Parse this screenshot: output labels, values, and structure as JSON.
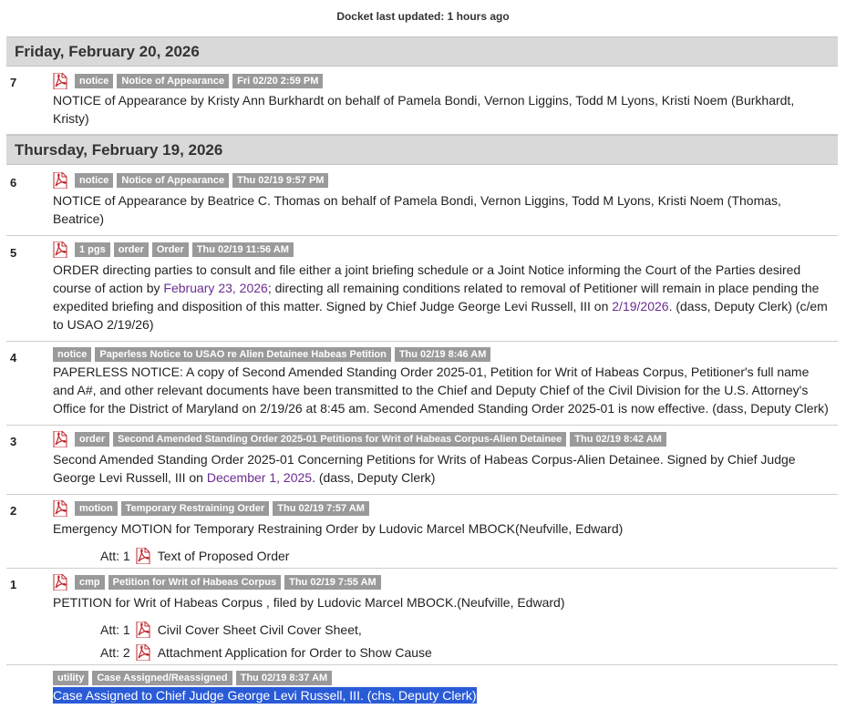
{
  "header": {
    "updated": "Docket last updated: 1 hours ago"
  },
  "days": [
    "Friday, February 20, 2026",
    "Thursday, February 19, 2026"
  ],
  "entries": [
    {
      "num": "7",
      "tags": [
        "notice",
        "Notice of Appearance",
        "Fri 02/20 2:59 PM"
      ],
      "text": "NOTICE of Appearance by Kristy Ann Burkhardt on behalf of Pamela Bondi, Vernon Liggins, Todd M Lyons, Kristi Noem (Burkhardt, Kristy)"
    },
    {
      "num": "6",
      "tags": [
        "notice",
        "Notice of Appearance",
        "Thu 02/19 9:57 PM"
      ],
      "text": "NOTICE of Appearance by Beatrice C. Thomas on behalf of Pamela Bondi, Vernon Liggins, Todd M Lyons, Kristi Noem (Thomas, Beatrice)"
    },
    {
      "num": "5",
      "tags": [
        "1 pgs",
        "order",
        "Order",
        "Thu 02/19 11:56 AM"
      ],
      "text_a": "ORDER directing parties to consult and file either a joint briefing schedule or a Joint Notice informing the Court of the Parties desired course of action by ",
      "link_a": "February 23, 2026",
      "text_b": "; directing all remaining conditions related to removal of Petitioner will remain in place pending the expedited briefing and disposition of this matter. Signed by Chief Judge George Levi Russell, III on ",
      "link_b": "2/19/2026",
      "text_c": ". (dass, Deputy Clerk) (c/em to USAO 2/19/26)"
    },
    {
      "num": "4",
      "tags": [
        "notice",
        "Paperless Notice to USAO re Alien Detainee Habeas Petition",
        "Thu 02/19 8:46 AM"
      ],
      "text": "PAPERLESS NOTICE: A copy of Second Amended Standing Order 2025-01, Petition for Writ of Habeas Corpus, Petitioner's full name and A#, and other relevant documents have been transmitted to the Chief and Deputy Chief of the Civil Division for the U.S. Attorney's Office for the District of Maryland on 2/19/26 at 8:45 am. Second Amended Standing Order 2025-01 is now effective. (dass, Deputy Clerk)"
    },
    {
      "num": "3",
      "tags": [
        "order",
        "Second Amended Standing Order 2025-01 Petitions for Writ of Habeas Corpus-Alien Detainee",
        "Thu 02/19 8:42 AM"
      ],
      "text_a": "Second Amended Standing Order 2025-01 Concerning Petitions for Writs of Habeas Corpus-Alien Detainee. Signed by Chief Judge George Levi Russell, III on ",
      "link_a": "December 1, 2025",
      "text_b": ". (dass, Deputy Clerk)"
    },
    {
      "num": "2",
      "tags": [
        "motion",
        "Temporary Restraining Order",
        "Thu 02/19 7:57 AM"
      ],
      "text": "Emergency MOTION for Temporary Restraining Order by Ludovic Marcel MBOCK(Neufville, Edward)",
      "atts": [
        {
          "label": "Att: 1",
          "desc": "Text of Proposed Order"
        }
      ]
    },
    {
      "num": "1",
      "tags": [
        "cmp",
        "Petition for Writ of Habeas Corpus",
        "Thu 02/19 7:55 AM"
      ],
      "text": "PETITION for Writ of Habeas Corpus , filed by Ludovic Marcel MBOCK.(Neufville, Edward)",
      "atts": [
        {
          "label": "Att: 1",
          "desc": "Civil Cover Sheet Civil Cover Sheet,"
        },
        {
          "label": "Att: 2",
          "desc": "Attachment Application for Order to Show Cause"
        }
      ]
    },
    {
      "num": "",
      "tags": [
        "utility",
        "Case Assigned/Reassigned",
        "Thu 02/19 8:37 AM"
      ],
      "text": "Case Assigned to Chief Judge George Levi Russell, III. (chs, Deputy Clerk)"
    }
  ],
  "icons": {
    "pdf": "pdf-icon"
  },
  "colors": {
    "tag_bg": "#9a9a9a",
    "link": "#6a2c91",
    "highlight": "#2a5bd7",
    "day_bg": "#d9d9d9"
  }
}
